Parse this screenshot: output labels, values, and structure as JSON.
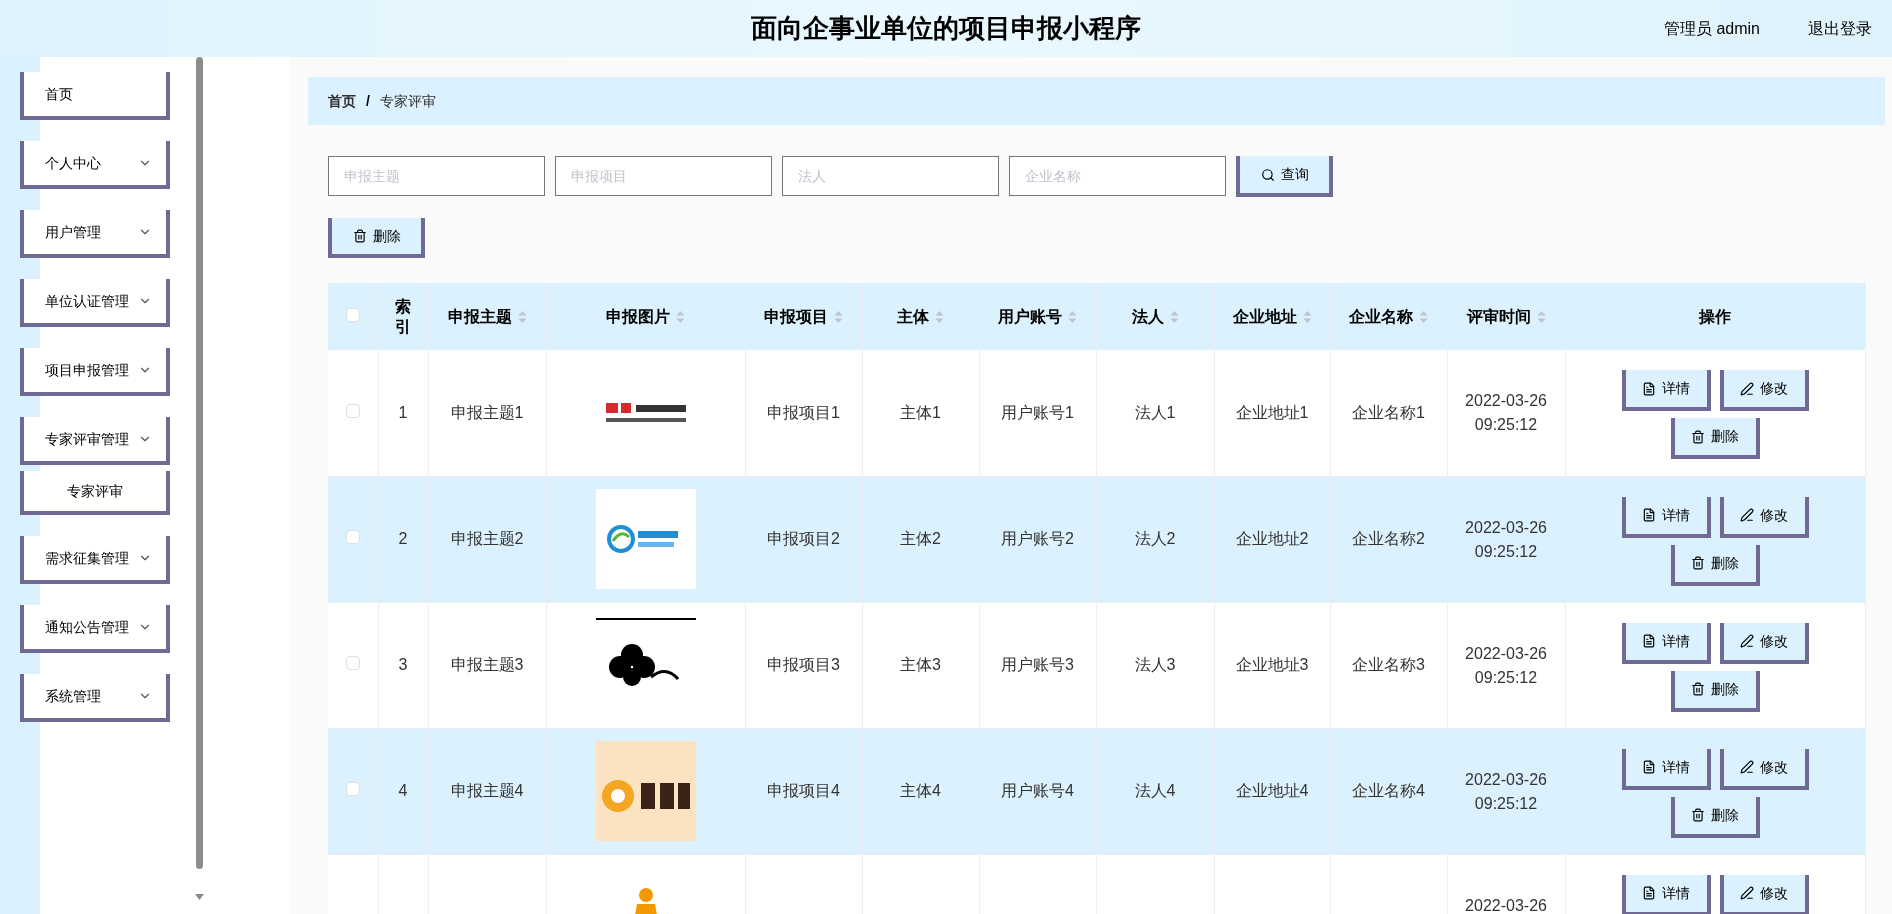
{
  "header": {
    "title": "面向企事业单位的项目申报小程序",
    "user": "管理员 admin",
    "logout": "退出登录"
  },
  "sidebar": {
    "items": [
      {
        "label": "首页",
        "kind": "link"
      },
      {
        "label": "个人中心",
        "kind": "menu"
      },
      {
        "label": "用户管理",
        "kind": "menu"
      },
      {
        "label": "单位认证管理",
        "kind": "menu"
      },
      {
        "label": "项目申报管理",
        "kind": "menu"
      },
      {
        "label": "专家评审管理",
        "kind": "menu",
        "children": [
          {
            "label": "专家评审"
          }
        ]
      },
      {
        "label": "需求征集管理",
        "kind": "menu"
      },
      {
        "label": "通知公告管理",
        "kind": "menu"
      },
      {
        "label": "系统管理",
        "kind": "menu"
      }
    ]
  },
  "breadcrumb": {
    "items": [
      "首页",
      "专家评审"
    ],
    "separator": "/"
  },
  "search": {
    "fields": [
      {
        "placeholder": "申报主题"
      },
      {
        "placeholder": "申报项目"
      },
      {
        "placeholder": "法人"
      },
      {
        "placeholder": "企业名称"
      }
    ],
    "button": "查询"
  },
  "toolbar": {
    "delete": "删除"
  },
  "table": {
    "header_checked": false,
    "columns": [
      {
        "label": "索引",
        "sortable": false
      },
      {
        "label": "申报主题",
        "sortable": true
      },
      {
        "label": "申报图片",
        "sortable": true
      },
      {
        "label": "申报项目",
        "sortable": true
      },
      {
        "label": "主体",
        "sortable": true
      },
      {
        "label": "用户账号",
        "sortable": true
      },
      {
        "label": "法人",
        "sortable": true
      },
      {
        "label": "企业地址",
        "sortable": true
      },
      {
        "label": "企业名称",
        "sortable": true
      },
      {
        "label": "评审时间",
        "sortable": true
      },
      {
        "label": "操作",
        "sortable": false
      }
    ],
    "rows": [
      {
        "checked": false,
        "index": "1",
        "subject": "申报主题1",
        "image": {
          "kind": "picture"
        },
        "project": "申报项目1",
        "entity": "主体1",
        "account": "用户账号1",
        "legal": "法人1",
        "address": "企业地址1",
        "company": "企业名称1",
        "date": "2022-03-26",
        "time": "09:25:12",
        "actions": [
          "详情",
          "修改",
          "删除"
        ]
      },
      {
        "checked": false,
        "index": "2",
        "subject": "申报主题2",
        "image": {
          "kind": "picture"
        },
        "project": "申报项目2",
        "entity": "主体2",
        "account": "用户账号2",
        "legal": "法人2",
        "address": "企业地址2",
        "company": "企业名称2",
        "date": "2022-03-26",
        "time": "09:25:12",
        "actions": [
          "详情",
          "修改",
          "删除"
        ]
      },
      {
        "checked": false,
        "index": "3",
        "subject": "申报主题3",
        "image": {
          "kind": "picture"
        },
        "project": "申报项目3",
        "entity": "主体3",
        "account": "用户账号3",
        "legal": "法人3",
        "address": "企业地址3",
        "company": "企业名称3",
        "date": "2022-03-26",
        "time": "09:25:12",
        "actions": [
          "详情",
          "修改",
          "删除"
        ]
      },
      {
        "checked": false,
        "index": "4",
        "subject": "申报主题4",
        "image": {
          "kind": "picture"
        },
        "project": "申报项目4",
        "entity": "主体4",
        "account": "用户账号4",
        "legal": "法人4",
        "address": "企业地址4",
        "company": "企业名称4",
        "date": "2022-03-26",
        "time": "09:25:12",
        "actions": [
          "详情",
          "修改",
          "删除"
        ]
      },
      {
        "image": {
          "kind": "picture"
        },
        "date": "2022-03-26",
        "actions": [
          "详情",
          "修改"
        ]
      }
    ]
  }
}
